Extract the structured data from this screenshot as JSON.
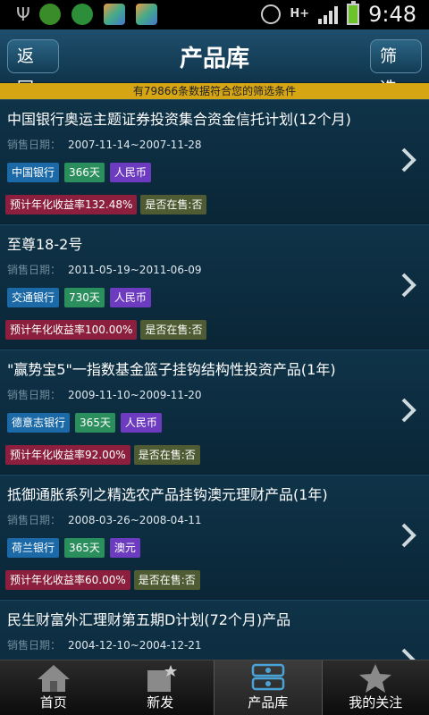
{
  "status": {
    "time": "9:48",
    "network": "H+"
  },
  "header": {
    "back_label": "返回",
    "title": "产品库",
    "filter_label": "筛选"
  },
  "notice": "有79866条数据符合您的筛选条件",
  "products": [
    {
      "title": "中国银行奥运主题证券投资集合资金信托计划(12个月)",
      "date_label": "销售日期：",
      "date_range": "2007-11-14~2007-11-28",
      "bank": "中国银行",
      "term": "366天",
      "currency": "人民币",
      "yield": "预计年化收益率132.48%",
      "on_sale": "是否在售:否"
    },
    {
      "title": "至尊18-2号",
      "date_label": "销售日期：",
      "date_range": "2011-05-19~2011-06-09",
      "bank": "交通银行",
      "term": "730天",
      "currency": "人民币",
      "yield": "预计年化收益率100.00%",
      "on_sale": "是否在售:否"
    },
    {
      "title": "\"赢势宝5\"一指数基金篮子挂钩结构性投资产品(1年)",
      "date_label": "销售日期：",
      "date_range": "2009-11-10~2009-11-20",
      "bank": "德意志银行",
      "term": "365天",
      "currency": "人民币",
      "yield": "预计年化收益率92.00%",
      "on_sale": "是否在售:否"
    },
    {
      "title": "抵御通胀系列之精选农产品挂钩澳元理财产品(1年)",
      "date_label": "销售日期：",
      "date_range": "2008-03-26~2008-04-11",
      "bank": "荷兰银行",
      "term": "365天",
      "currency": "澳元",
      "yield": "预计年化收益率60.00%",
      "on_sale": "是否在售:否"
    },
    {
      "title": "民生财富外汇理财第五期D计划(72个月)产品",
      "date_label": "销售日期：",
      "date_range": "2004-12-10~2004-12-21",
      "bank": "",
      "term": "",
      "currency": "",
      "yield": "",
      "on_sale": ""
    }
  ],
  "nav": [
    {
      "label": "首页",
      "icon": "home-icon"
    },
    {
      "label": "新发",
      "icon": "new-release-icon"
    },
    {
      "label": "产品库",
      "icon": "product-library-icon"
    },
    {
      "label": "我的关注",
      "icon": "star-icon"
    }
  ],
  "colors": {
    "notice_bg": "#d5a514",
    "bank_tag": "#1b69a6",
    "term_tag": "#2a8f5c",
    "currency_tag": "#6c3bc0",
    "yield_tag": "#8b1f3d",
    "sale_tag": "#4f5b32"
  }
}
